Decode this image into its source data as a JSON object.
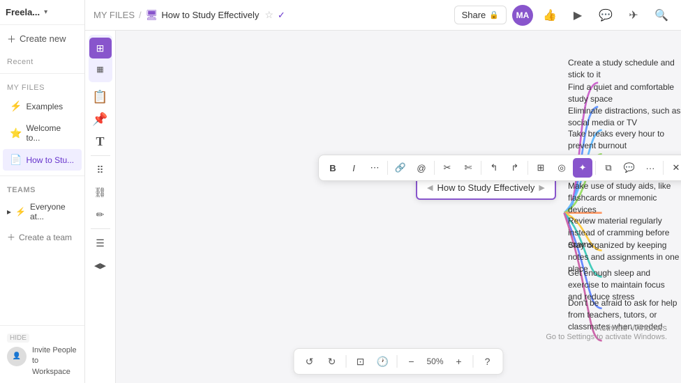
{
  "sidebar": {
    "workspace_name": "Freela...",
    "create_new_label": "Create new",
    "recent_label": "Recent",
    "my_files_label": "MY FILES",
    "items": [
      {
        "id": "examples",
        "label": "Examples",
        "icon": "⚡"
      },
      {
        "id": "welcome",
        "label": "Welcome to...",
        "icon": "⭐"
      },
      {
        "id": "how-to",
        "label": "How to Stu...",
        "icon": "📄",
        "active": true
      }
    ],
    "teams_label": "TEAMS",
    "teams_items": [
      {
        "id": "everyone",
        "label": "Everyone at...",
        "icon": "⚡"
      }
    ],
    "create_team_label": "Create a team",
    "invite_hide_label": "HIDE",
    "invite_text": "Invite People to Workspace"
  },
  "topbar": {
    "my_files_label": "MY FILES",
    "doc_title": "How to Study Effectively",
    "share_label": "Share",
    "avatar_initials": "MA",
    "avatar_color": "#8855cc"
  },
  "floating_toolbar": {
    "buttons": [
      {
        "id": "bold",
        "label": "B"
      },
      {
        "id": "italic",
        "label": "I"
      },
      {
        "id": "more",
        "label": "⋯"
      },
      {
        "id": "link",
        "label": "🔗"
      },
      {
        "id": "mention",
        "label": "@"
      },
      {
        "id": "cut",
        "label": "✂"
      },
      {
        "id": "scissors2",
        "label": "✄"
      },
      {
        "id": "curve-left",
        "label": "↰"
      },
      {
        "id": "curve-right",
        "label": "↱"
      },
      {
        "id": "grid",
        "label": "⊞"
      },
      {
        "id": "target",
        "label": "◎"
      },
      {
        "id": "star-active",
        "label": "✦",
        "active": true
      },
      {
        "id": "copy",
        "label": "⧉"
      },
      {
        "id": "comment",
        "label": "💬"
      },
      {
        "id": "dots",
        "label": "···"
      },
      {
        "id": "close",
        "label": "✕"
      }
    ]
  },
  "mindmap": {
    "central_node": "How to Study Effectively",
    "branches": [
      {
        "id": 1,
        "text": "Create a study schedule and stick to it",
        "color": "#cc66cc"
      },
      {
        "id": 2,
        "text": "Find a quiet and comfortable study space",
        "color": "#6699ff"
      },
      {
        "id": 3,
        "text": "Eliminate distractions, such as social media or TV",
        "color": "#66bbff"
      },
      {
        "id": 4,
        "text": "Take breaks every hour to prevent burnout",
        "color": "#99dd66"
      },
      {
        "id": 5,
        "text": "Make use of study aids, like flashcards or mnemonic devices",
        "color": "#ff9966"
      },
      {
        "id": 6,
        "text": "Review material regularly instead of cramming before exams",
        "color": "#ffcc44"
      },
      {
        "id": 7,
        "text": "Stay organized by keeping notes and assignments in one place",
        "color": "#44ccbb"
      },
      {
        "id": 8,
        "text": "Get enough sleep and exercise to maintain focus and reduce stress",
        "color": "#6688ff"
      },
      {
        "id": 9,
        "text": "Don't be afraid to ask for help from teachers, tutors, or classmates when needed",
        "color": "#cc66aa"
      }
    ]
  },
  "bottom_toolbar": {
    "undo_label": "↺",
    "redo_label": "↻",
    "zoom_out_label": "−",
    "zoom_percent": "50%",
    "zoom_in_label": "+",
    "fit_label": "⊡",
    "clock_label": "🕐",
    "help_label": "?"
  },
  "watermark": {
    "title": "Activate Windows",
    "subtitle": "Go to Settings to activate Windows."
  }
}
